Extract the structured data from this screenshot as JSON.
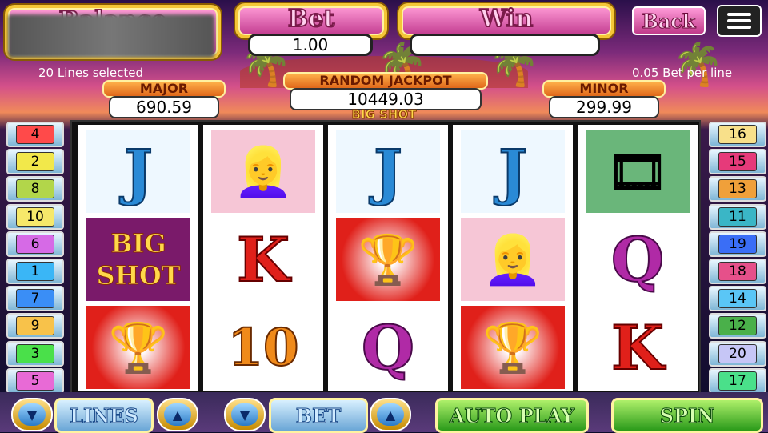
{
  "header": {
    "balance_title": "Balance",
    "bet_title": "Bet",
    "bet_value": "1.00",
    "win_title": "Win",
    "win_value": "",
    "back_label": "Back",
    "menu_icon": "menu-icon"
  },
  "info": {
    "lines_selected": "20 Lines selected",
    "bet_per_line": "0.05 Bet per line"
  },
  "jackpots": {
    "major_label": "MAJOR",
    "major_value": "690.59",
    "random_label": "RANDOM JACKPOT",
    "random_value": "10449.03",
    "minor_label": "MINOR",
    "minor_value": "299.99",
    "game_title": "BIG SHOT"
  },
  "reels": [
    [
      "J",
      "BIG SHOT",
      "trophy"
    ],
    [
      "starlet",
      "K",
      "10"
    ],
    [
      "J",
      "trophy",
      "Q"
    ],
    [
      "J",
      "starlet",
      "trophy"
    ],
    [
      "film-reel",
      "Q",
      "K"
    ]
  ],
  "left_lines": [
    "4",
    "2",
    "8",
    "10",
    "6",
    "1",
    "7",
    "9",
    "3",
    "5"
  ],
  "right_lines": [
    "16",
    "15",
    "13",
    "11",
    "19",
    "18",
    "14",
    "12",
    "20",
    "17"
  ],
  "controls": {
    "lines_label": "LINES",
    "bet_label": "BET",
    "auto_label": "AUTO PLAY",
    "spin_label": "SPIN"
  },
  "colors": {
    "left_lines": [
      "#ff4a4a",
      "#f2e84a",
      "#b2d64a",
      "#f6e86a",
      "#d66ae6",
      "#3ab6f6",
      "#3a8ef6",
      "#f8c24a",
      "#4ae04a",
      "#e86ad6"
    ],
    "right_lines": [
      "#f8e08a",
      "#e63a7a",
      "#f0a03a",
      "#3ab6c6",
      "#3a6ef6",
      "#e6508a",
      "#5ac6f6",
      "#4ab04a",
      "#c6c6f6",
      "#4ae08a"
    ]
  }
}
